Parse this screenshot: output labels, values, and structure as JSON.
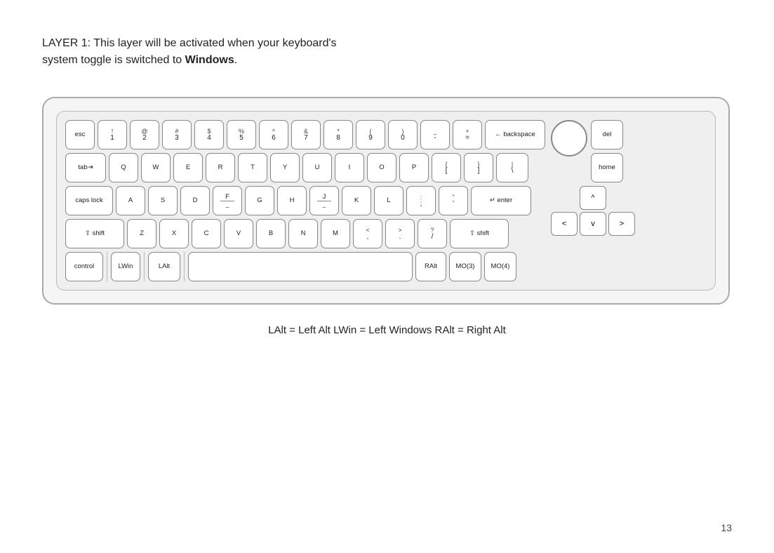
{
  "title_line1": "LAYER 1: This layer will be activated when your keyboard's",
  "title_line2": "system toggle is switched to ",
  "title_bold": "Windows",
  "title_end": ".",
  "caption": "LAlt = Left Alt   LWin = Left Windows   RAlt = Right Alt",
  "page_number": "13",
  "rows": [
    {
      "keys": [
        {
          "label": "esc",
          "type": "single"
        },
        {
          "top": "!",
          "bottom": "1"
        },
        {
          "top": "@",
          "bottom": "2"
        },
        {
          "top": "#",
          "bottom": "3"
        },
        {
          "top": "$",
          "bottom": "4"
        },
        {
          "top": "%",
          "bottom": "5"
        },
        {
          "top": "^",
          "bottom": "6"
        },
        {
          "top": "&",
          "bottom": "7"
        },
        {
          "top": "*",
          "bottom": "8"
        },
        {
          "top": "(",
          "bottom": "9"
        },
        {
          "top": ")",
          "bottom": "0"
        },
        {
          "top": "_",
          "bottom": "-"
        },
        {
          "top": "+",
          "bottom": "="
        },
        {
          "label": "← backspace",
          "type": "wide",
          "cls": "w-backspace"
        }
      ]
    },
    {
      "keys": [
        {
          "label": "tab⇥",
          "type": "wide",
          "cls": "w-tab"
        },
        {
          "label": "Q"
        },
        {
          "label": "W"
        },
        {
          "label": "E"
        },
        {
          "label": "R"
        },
        {
          "label": "T"
        },
        {
          "label": "Y"
        },
        {
          "label": "U"
        },
        {
          "label": "I"
        },
        {
          "label": "O"
        },
        {
          "label": "P"
        },
        {
          "top": "{",
          "bottom": "["
        },
        {
          "top": "}",
          "bottom": "]"
        },
        {
          "top": "|",
          "bottom": "\\",
          "cls": "w-bslash"
        }
      ]
    },
    {
      "keys": [
        {
          "label": "caps lock",
          "type": "wide",
          "cls": "w-caps"
        },
        {
          "label": "A"
        },
        {
          "label": "S"
        },
        {
          "label": "D"
        },
        {
          "label": "F",
          "sub": "_"
        },
        {
          "label": "G"
        },
        {
          "label": "H"
        },
        {
          "label": "J",
          "sub": "_"
        },
        {
          "label": "K"
        },
        {
          "label": "L"
        },
        {
          "top": ":",
          "bottom": ";"
        },
        {
          "top": "\"",
          "bottom": "'"
        },
        {
          "label": "↵ enter",
          "type": "wide",
          "cls": "w-enter"
        }
      ]
    },
    {
      "keys": [
        {
          "label": "⇧ shift",
          "type": "wide",
          "cls": "w-shift-l"
        },
        {
          "label": "Z"
        },
        {
          "label": "X"
        },
        {
          "label": "C"
        },
        {
          "label": "V"
        },
        {
          "label": "B"
        },
        {
          "label": "N"
        },
        {
          "label": "M"
        },
        {
          "top": "<",
          "bottom": ","
        },
        {
          "top": ">",
          "bottom": "."
        },
        {
          "top": "?",
          "bottom": "/"
        },
        {
          "label": "⇧ shift",
          "type": "wide",
          "cls": "w-shift-r"
        }
      ]
    },
    {
      "keys": [
        {
          "label": "control",
          "type": "wide",
          "cls": "w-ctrl"
        },
        {
          "label": "LWin",
          "cls": "w-lwin"
        },
        {
          "label": "LAlt",
          "cls": "w-lalt"
        },
        {
          "label": "",
          "type": "space",
          "cls": "w-space"
        },
        {
          "label": "RAlt",
          "cls": "w-ralt"
        },
        {
          "label": "MO(3)",
          "cls": "w-mo3"
        },
        {
          "label": "MO(4)",
          "cls": "w-mo4"
        }
      ]
    }
  ],
  "right_keys": {
    "del": "del",
    "home": "home",
    "up": "^",
    "left": "<",
    "down": "v",
    "right": ">"
  }
}
